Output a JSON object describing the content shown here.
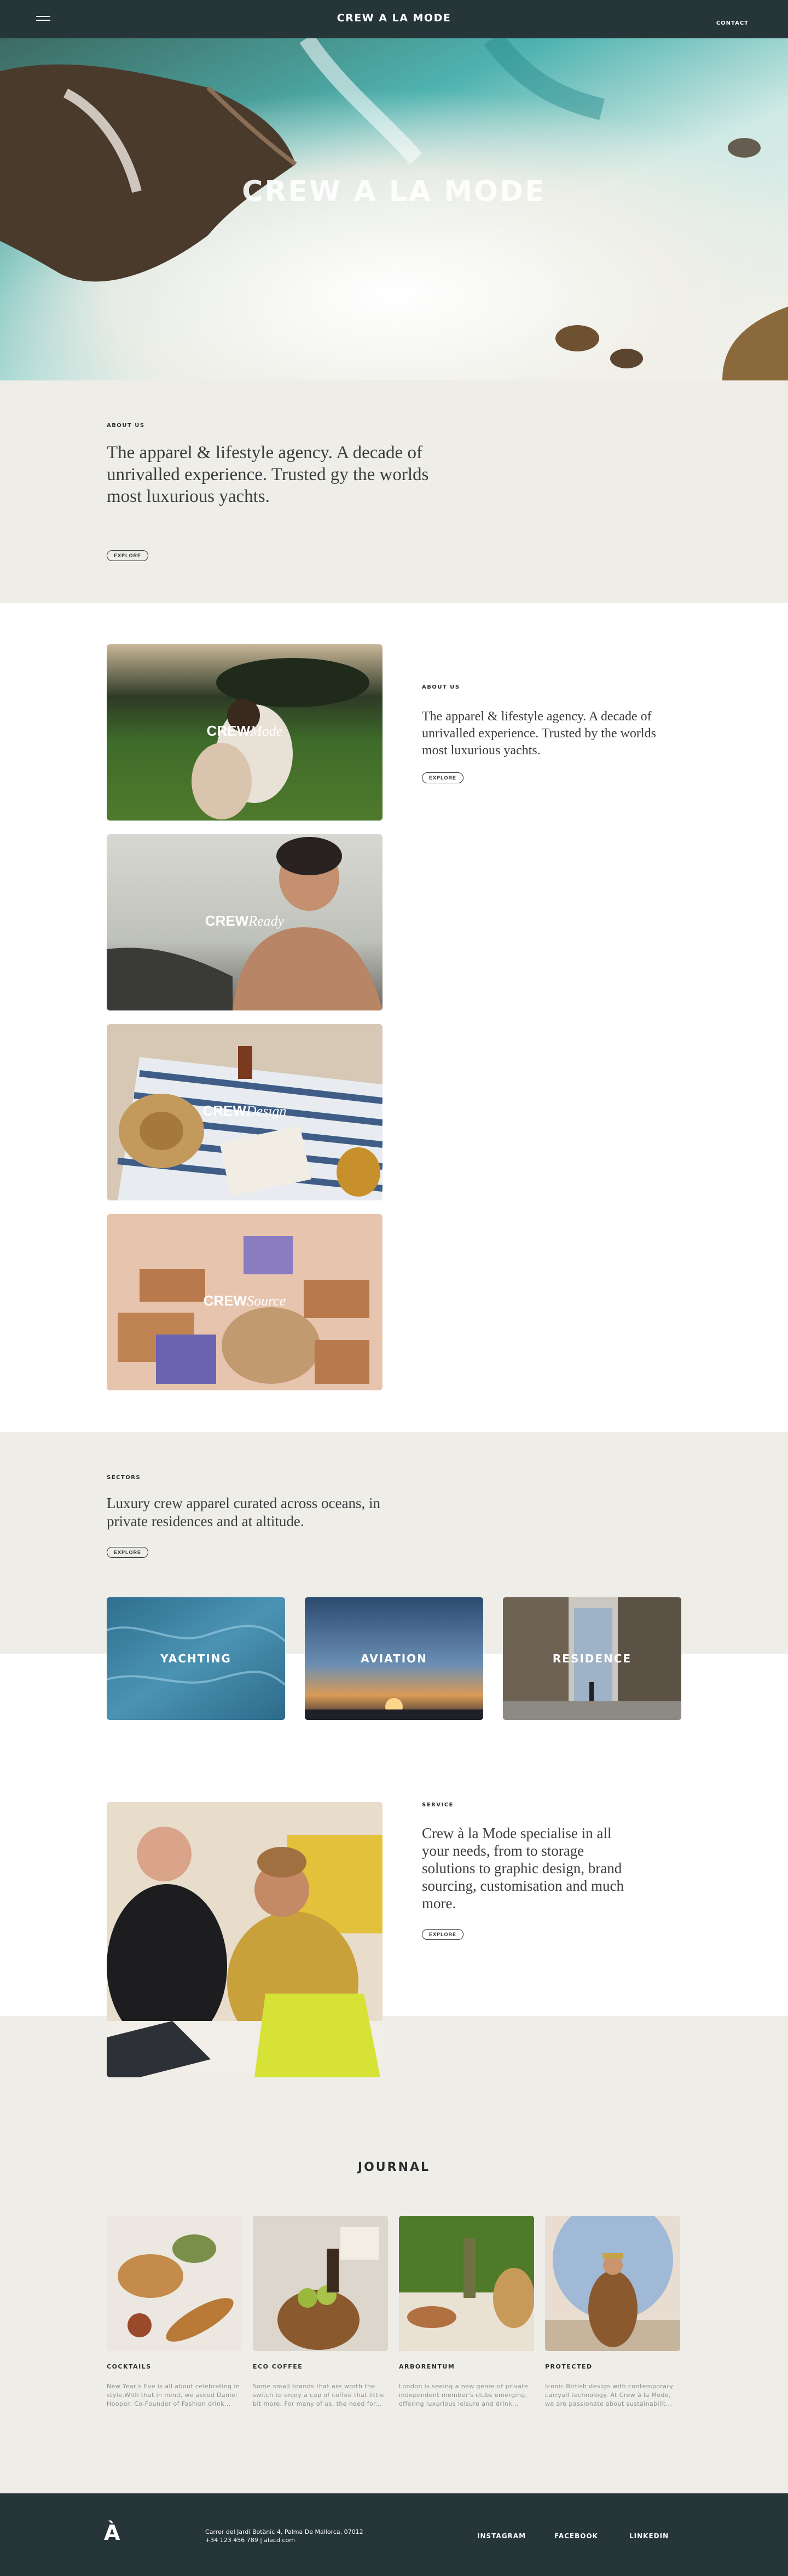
{
  "nav": {
    "title": "CREW A LA MODE",
    "contact": "CONTACT",
    "menu_icon": "hamburger-icon"
  },
  "hero": {
    "title": "CREW A LA MODE"
  },
  "about": {
    "label": "ABOUT US",
    "text": "The apparel & lifestyle agency. A decade of unrivalled experience. Trusted gy the worlds most luxurious yachts.",
    "cta": "EXPLORE"
  },
  "brands": [
    {
      "bold": "CREW",
      "italic": "Mode"
    },
    {
      "bold": "CREW",
      "italic": "Ready"
    },
    {
      "bold": "CREW",
      "italic": "Design"
    },
    {
      "bold": "CREW",
      "italic": "Source"
    }
  ],
  "side_about": {
    "label": "ABOUT US",
    "text": "The apparel & lifestyle agency. A decade of unrivalled experience. Trusted by the worlds most luxurious yachts.",
    "cta": "EXPLORE"
  },
  "sectors": {
    "label": "SECTORS",
    "text": "Luxury crew apparel curated across oceans, in private residences and at altitude.",
    "cta": "EXPLORE",
    "tiles": [
      "YACHTING",
      "AVIATION",
      "RESIDENCE"
    ]
  },
  "service": {
    "label": "SERVICE",
    "text": "Crew à la Mode specialise in all your needs, from to storage solutions to graphic design, brand sourcing, customisation and much more.",
    "cta": "EXPLORE"
  },
  "journal": {
    "title": "JOURNAL",
    "posts": [
      {
        "title": "COCKTAILS",
        "text": "New Year's Eve is all about celebrating in style.With that in mind, we asked Daniel Hooper, Co-Founder of Fashion drink..."
      },
      {
        "title": "ECO COFFEE",
        "text": "Some small brands that are worth the switch to enjoy a cup of coffee that little bit more. For many of us, the need for..."
      },
      {
        "title": "ARBORENTUM",
        "text": "London is seeing a new genre of private independent member's clubs emerging, offering luxurious leisure and drink..."
      },
      {
        "title": "PROTECTED",
        "text": "Iconic British design with contemporary carryall technology. At Crew à la Mode, we are passionate about sustainabilit..."
      }
    ]
  },
  "footer": {
    "logo": "À",
    "address_line1": "Carrer del Jardí Botànic 4, Palma De Mallorca, 07012",
    "address_line2": "+34 123 456 789 | alacd.com",
    "links": [
      "INSTAGRAM",
      "FACEBOOK",
      "LINKEDIN"
    ]
  }
}
